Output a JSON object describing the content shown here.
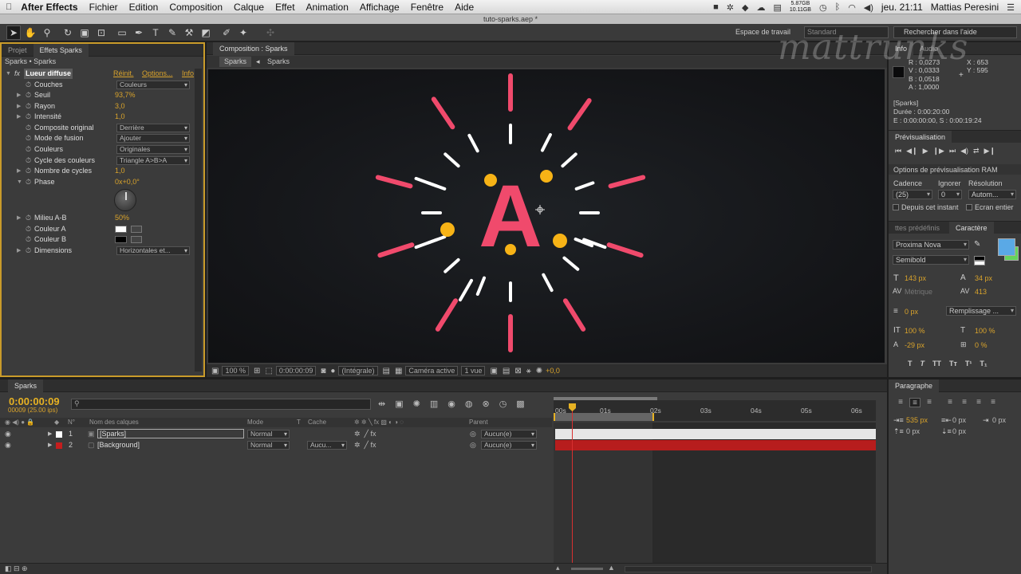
{
  "menubar": {
    "app": "After Effects",
    "items": [
      "Fichier",
      "Edition",
      "Composition",
      "Calque",
      "Effet",
      "Animation",
      "Affichage",
      "Fenêtre",
      "Aide"
    ],
    "storage_top": "5.87GB",
    "storage_bottom": "10.11GB",
    "clock": "jeu. 21:11",
    "user": "Mattias Peresini"
  },
  "window": {
    "title": "tuto-sparks.aep *"
  },
  "toolbar": {
    "workspace_label": "Espace de travail",
    "workspace_value": "Standard",
    "help_placeholder": "Rechercher dans l'aide"
  },
  "effects_panel": {
    "tabs": [
      "Projet",
      "Effets Sparks"
    ],
    "breadcrumb": "Sparks • Sparks",
    "effect_name": "Lueur diffuse",
    "links": [
      "Réinit.",
      "Options...",
      "Info"
    ],
    "props": [
      {
        "label": "Couches",
        "type": "dropdown",
        "value": "Couleurs"
      },
      {
        "label": "Seuil",
        "type": "value",
        "value": "93,7%"
      },
      {
        "label": "Rayon",
        "type": "value",
        "value": "3,0"
      },
      {
        "label": "Intensité",
        "type": "value",
        "value": "1,0"
      },
      {
        "label": "Composite original",
        "type": "dropdown",
        "value": "Derrière"
      },
      {
        "label": "Mode de fusion",
        "type": "dropdown",
        "value": "Ajouter"
      },
      {
        "label": "Couleurs",
        "type": "dropdown",
        "value": "Originales"
      },
      {
        "label": "Cycle des couleurs",
        "type": "dropdown",
        "value": "Triangle A>B>A"
      },
      {
        "label": "Nombre de cycles",
        "type": "value",
        "value": "1,0"
      },
      {
        "label": "Phase",
        "type": "value",
        "value": "0x+0,0°"
      },
      {
        "label": "Milieu A-B",
        "type": "value",
        "value": "50%"
      },
      {
        "label": "Couleur A",
        "type": "color",
        "value": "#ffffff"
      },
      {
        "label": "Couleur B",
        "type": "color",
        "value": "#000000"
      },
      {
        "label": "Dimensions",
        "type": "dropdown",
        "value": "Horizontales et..."
      }
    ]
  },
  "composition": {
    "tab": "Composition : Sparks",
    "crumbs": [
      "Sparks",
      "Sparks"
    ],
    "letter": "A",
    "accent": "#f04a6c",
    "dot_color": "#f7b316",
    "bottom": {
      "zoom": "100 %",
      "timecode": "0:00:00:09",
      "resolution": "(Intégrale)",
      "camera": "Caméra active",
      "views": "1 vue",
      "exposure": "+0,0"
    }
  },
  "info_panel": {
    "tabs": [
      "Info",
      "Audio"
    ],
    "r": "R : 0,0273",
    "v": "V : 0,0333",
    "b": "B : 0,0518",
    "a": "A : 1,0000",
    "x": "X : 653",
    "y": "Y : 595",
    "comp": "[Sparks]",
    "duration": "Durée : 0:00:20:00",
    "in_out": "E : 0:00:00:00, S : 0:00:19:24"
  },
  "preview_panel": {
    "title": "Prévisualisation",
    "ram_options": "Options de prévisualisation RAM",
    "cadence_label": "Cadence",
    "ignore_label": "Ignorer",
    "res_label": "Résolution",
    "cadence": "(25)",
    "ignore": "0",
    "res": "Autom...",
    "from_here": "Depuis cet instant",
    "fullscreen": "Ecran entier"
  },
  "character_panel": {
    "tabs": [
      "ttes prédéfinis",
      "Caractère"
    ],
    "font": "Proxima Nova",
    "weight": "Semibold",
    "size": "143 px",
    "leading": "34 px",
    "kerning": "Métrique",
    "tracking": "413",
    "stroke": "0 px",
    "stroke_mode": "Remplissage ...",
    "vscale": "100 %",
    "hscale": "100 %",
    "baseline": "-29 px",
    "tsume": "0 %",
    "styles": [
      "T",
      "T",
      "TT",
      "Tт",
      "T¹",
      "T₁"
    ]
  },
  "timeline": {
    "tab": "Sparks",
    "timecode": "0:00:00:09",
    "frames": "00009 (25.00 ips)",
    "col_num": "N°",
    "col_name": "Nom des calques",
    "col_mode": "Mode",
    "col_t": "T",
    "col_cache": "Cache",
    "col_parent": "Parent",
    "layers": [
      {
        "num": "1",
        "name": "[Sparks]",
        "mode": "Normal",
        "cache": "",
        "parent": "Aucun(e)",
        "color": "#ffffff"
      },
      {
        "num": "2",
        "name": "[Background]",
        "mode": "Normal",
        "cache": "Aucu...",
        "parent": "Aucun(e)",
        "color": "#c41e1e"
      }
    ],
    "ruler": [
      "00s",
      "01s",
      "02s",
      "03s",
      "04s",
      "05s",
      "06s"
    ],
    "playhead_time": "0:00:00:09"
  },
  "paragraph_panel": {
    "title": "Paragraphe",
    "indent_left": "535 px",
    "indent_right": "0 px",
    "first_line": "0 px",
    "space_before": "0 px",
    "space_after": "0 px"
  },
  "watermark": "mattrunks"
}
